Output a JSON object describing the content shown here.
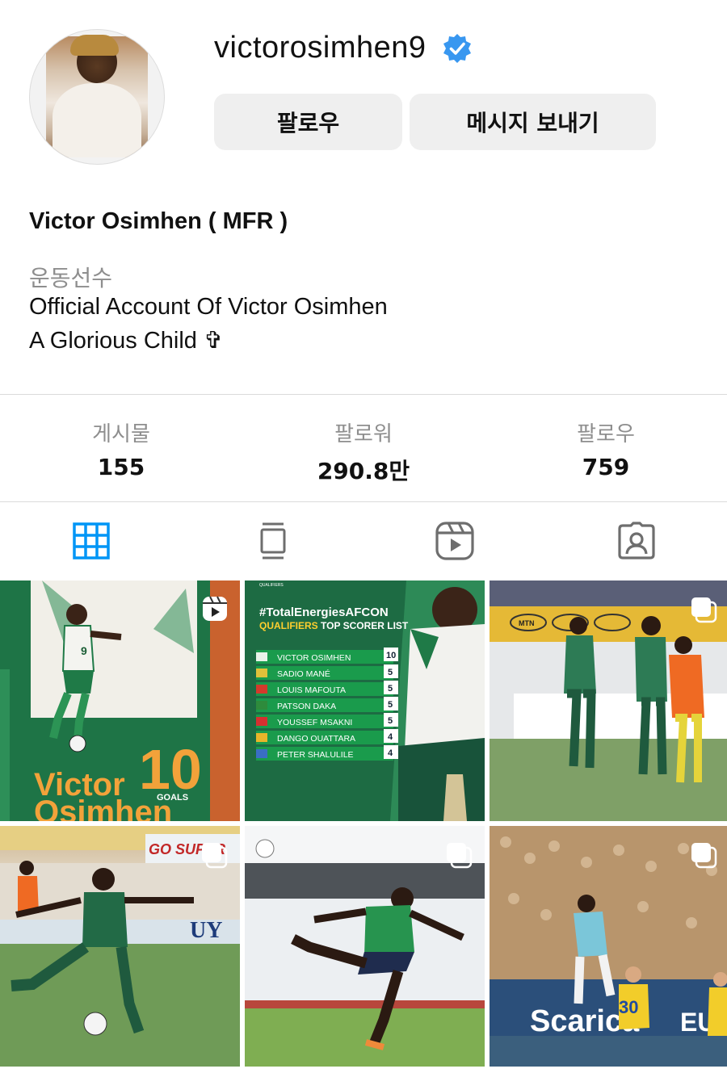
{
  "profile": {
    "username": "victorosimhen9",
    "verified": true,
    "full_name": "Victor Osimhen ( MFR )",
    "category": "운동선수",
    "bio_line1": "Official Account Of Victor Osimhen",
    "bio_line2": "A Glorious Child ✞",
    "avatar_icon": "profile-photo"
  },
  "buttons": {
    "follow": "팔로우",
    "message": "메시지 보내기"
  },
  "stats": [
    {
      "label": "게시물",
      "value": "155"
    },
    {
      "label": "팔로워",
      "value": "290.8만"
    },
    {
      "label": "팔로우",
      "value": "759"
    }
  ],
  "tabs": [
    {
      "icon": "grid-icon",
      "active": true
    },
    {
      "icon": "feed-icon",
      "active": false
    },
    {
      "icon": "reels-icon",
      "active": false
    },
    {
      "icon": "tagged-icon",
      "active": false
    }
  ],
  "colors": {
    "accent": "#0095f6",
    "verified": "#3897f0",
    "button_bg": "#efefef",
    "muted_text": "#8e8e8e",
    "inactive_icon": "#6e6e6e"
  },
  "posts": [
    {
      "type": "reel",
      "text_name": "Victor",
      "text_surname": "Osimhen",
      "text_number": "10",
      "text_goals": "GOALS"
    },
    {
      "type": "image",
      "header": "QUALIFIERS",
      "title": "#TotalEnergiesAFCON",
      "subtitle_q": "QUALIFIERS",
      "subtitle_rest": " TOP SCORER LIST",
      "rows": [
        {
          "name": "VICTOR OSIMHEN",
          "goals": "10"
        },
        {
          "name": "SADIO MANÉ",
          "goals": "5"
        },
        {
          "name": "LOUIS MAFOUTA",
          "goals": "5"
        },
        {
          "name": "PATSON DAKA",
          "goals": "5"
        },
        {
          "name": "YOUSSEF MSAKNI",
          "goals": "5"
        },
        {
          "name": "DANGO OUATTARA",
          "goals": "4"
        },
        {
          "name": "PETER SHALULILE",
          "goals": "4"
        }
      ]
    },
    {
      "type": "carousel",
      "sign_text": "MTN"
    },
    {
      "type": "carousel",
      "banner_text": "GO SUPER",
      "board_text": "UY"
    },
    {
      "type": "carousel"
    },
    {
      "type": "carousel",
      "banner_text": "Scarica",
      "board_text": "EURO",
      "shirt_number": "30"
    }
  ]
}
